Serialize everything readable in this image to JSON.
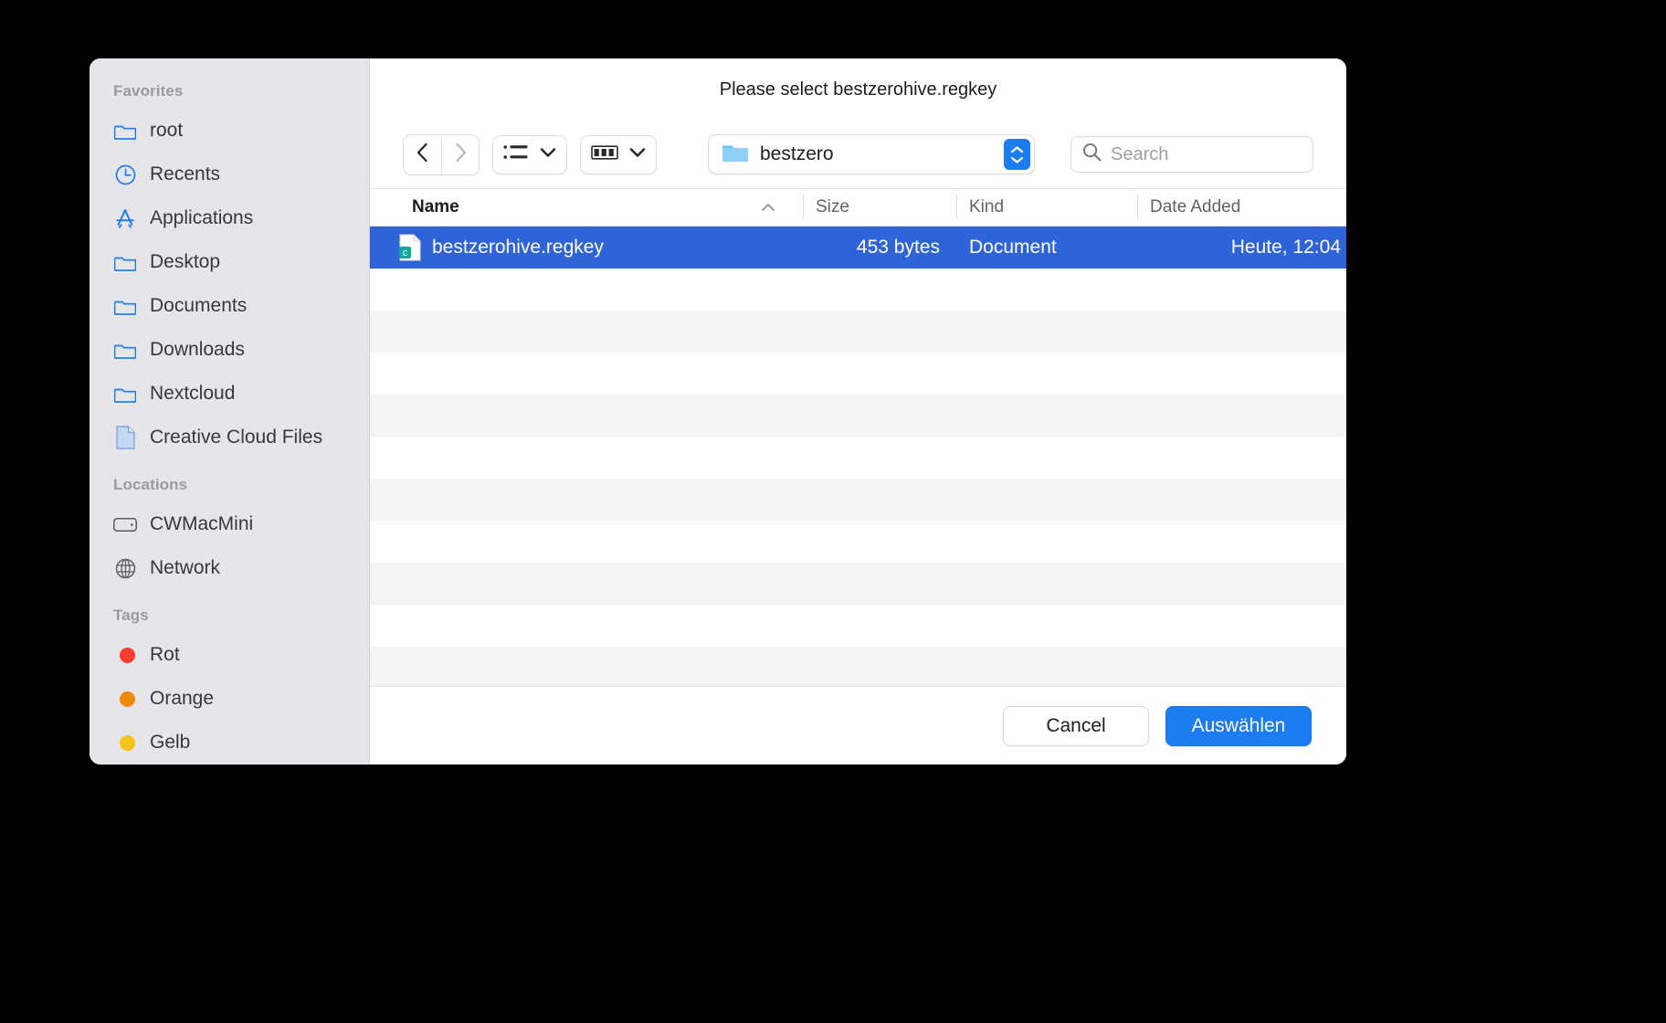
{
  "dialog": {
    "title": "Please select bestzerohive.regkey"
  },
  "sidebar": {
    "groups": [
      {
        "title": "Favorites",
        "items": [
          {
            "label": "root",
            "icon": "folder-icon"
          },
          {
            "label": "Recents",
            "icon": "clock-icon"
          },
          {
            "label": "Applications",
            "icon": "applications-icon"
          },
          {
            "label": "Desktop",
            "icon": "folder-icon"
          },
          {
            "label": "Documents",
            "icon": "folder-icon"
          },
          {
            "label": "Downloads",
            "icon": "folder-icon"
          },
          {
            "label": "Nextcloud",
            "icon": "folder-icon"
          },
          {
            "label": "Creative Cloud Files",
            "icon": "document-icon"
          }
        ]
      },
      {
        "title": "Locations",
        "items": [
          {
            "label": "CWMacMini",
            "icon": "harddrive-icon"
          },
          {
            "label": "Network",
            "icon": "globe-icon"
          }
        ]
      },
      {
        "title": "Tags",
        "items": [
          {
            "label": "Rot",
            "icon": "tag-dot-icon",
            "color": "#fa3b2d"
          },
          {
            "label": "Orange",
            "icon": "tag-dot-icon",
            "color": "#f08a0c"
          },
          {
            "label": "Gelb",
            "icon": "tag-dot-icon",
            "color": "#f5c419"
          }
        ]
      }
    ]
  },
  "toolbar": {
    "back_icon": "chevron-left-icon",
    "forward_icon": "chevron-right-icon",
    "list_view_icon": "list-view-icon",
    "icon_view_icon": "icon-view-icon",
    "path_label": "bestzero",
    "path_icon": "folder-icon",
    "stepper_icon": "stepper-updown-icon",
    "search_icon": "search-icon",
    "search_placeholder": "Search",
    "search_value": ""
  },
  "file_table": {
    "columns": [
      {
        "label": "Name",
        "sort": "ascending",
        "sort_icon": "chevron-up-icon"
      },
      {
        "label": "Size"
      },
      {
        "label": "Kind"
      },
      {
        "label": "Date Added"
      }
    ],
    "rows": [
      {
        "name": "bestzerohive.regkey",
        "size": "453 bytes",
        "kind": "Document",
        "date_added": "Heute, 12:04",
        "icon": "regkey-file-icon",
        "selected": true
      }
    ],
    "empty_row_count": 10
  },
  "footer": {
    "cancel_label": "Cancel",
    "confirm_label": "Auswählen"
  },
  "colors": {
    "accent": "#1c7cf2",
    "selection": "#2f63d8",
    "sidebar_bg": "#e6e5e9",
    "folder_blue": "#1c7cf2"
  }
}
